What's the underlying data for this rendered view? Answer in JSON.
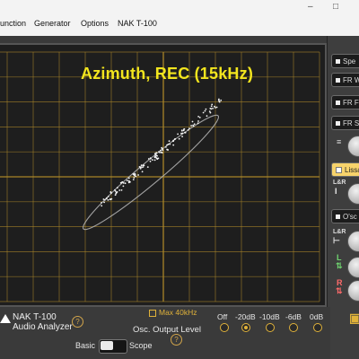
{
  "menu": {
    "items": [
      "unction",
      "Generator",
      "Options",
      "NAK T-100"
    ],
    "window_buttons": [
      "–",
      "□"
    ]
  },
  "scope": {
    "title": "Azimuth, REC (15kHz)",
    "max_filter_label": "Max 40kHz"
  },
  "right_panel": {
    "buttons": [
      "Spe",
      "FR W",
      "FR F",
      "FR S",
      "Lissa",
      "O'sc"
    ],
    "channel_labels": [
      "L&R",
      "L&R",
      "L",
      "R"
    ]
  },
  "logo": {
    "line1": "NAK T-100",
    "line2": "Audio Analyzer"
  },
  "osc_output": {
    "label": "Osc. Output Level",
    "options": [
      "Off",
      "-20dB",
      "-10dB",
      "-6dB",
      "0dB"
    ],
    "selected": "-20dB"
  },
  "mode_toggle": {
    "left": "Basic",
    "right": "Scope",
    "selected": "Basic"
  },
  "colors": {
    "title_yellow": "#f2e51e",
    "grid": "#b08a2a",
    "accent": "#e0b23a",
    "button_highlight": "#f7d36b"
  }
}
